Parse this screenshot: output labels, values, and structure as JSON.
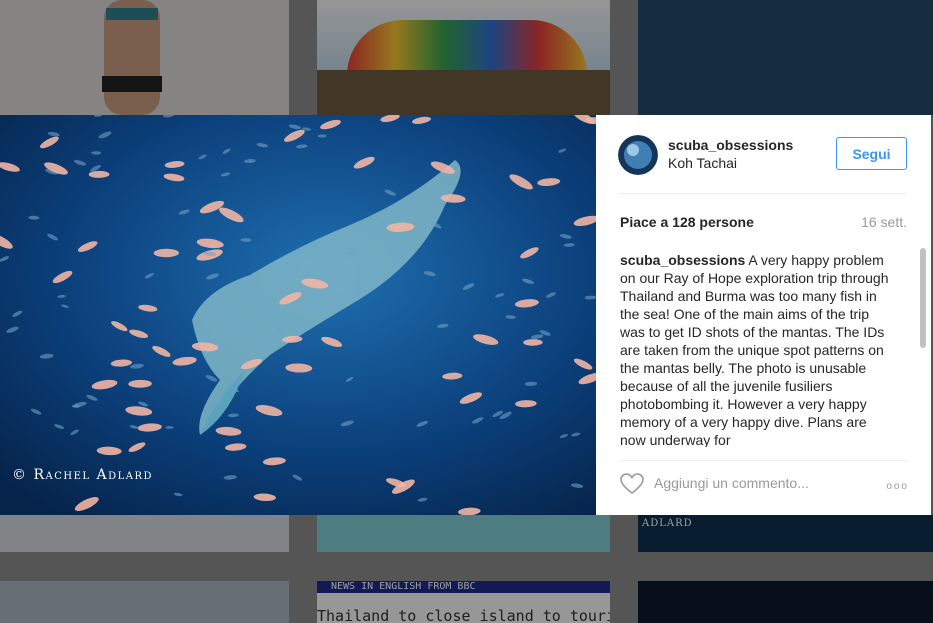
{
  "photo": {
    "credit": "© Rachel Adlard"
  },
  "post": {
    "username": "scuba_obsessions",
    "location": "Koh Tachai",
    "follow_label": "Segui",
    "likes": "Piace a 128 persone",
    "age": "16 sett.",
    "caption_user": "scuba_obsessions",
    "caption_text": " A very happy problem on our Ray of Hope exploration trip through Thailand and Burma was too many fish in the sea! One of the main aims of the trip was to get ID shots of the mantas. The IDs are taken from the unique spot patterns on the mantas belly. The photo is unusable because of all the juvenile fusiliers photobombing it. However a very happy memory of a very happy dive. Plans are now underway for",
    "comment_placeholder": "Aggiungi un commento...",
    "more_label": "ooo"
  },
  "background": {
    "tile_credit": "Adlard",
    "news_header": "NEWS IN ENGLISH FROM BBC",
    "news_headline": "Thailand to close island to tourists"
  },
  "colors": {
    "accent": "#3897f0",
    "ocean": "#0b3f7a"
  }
}
